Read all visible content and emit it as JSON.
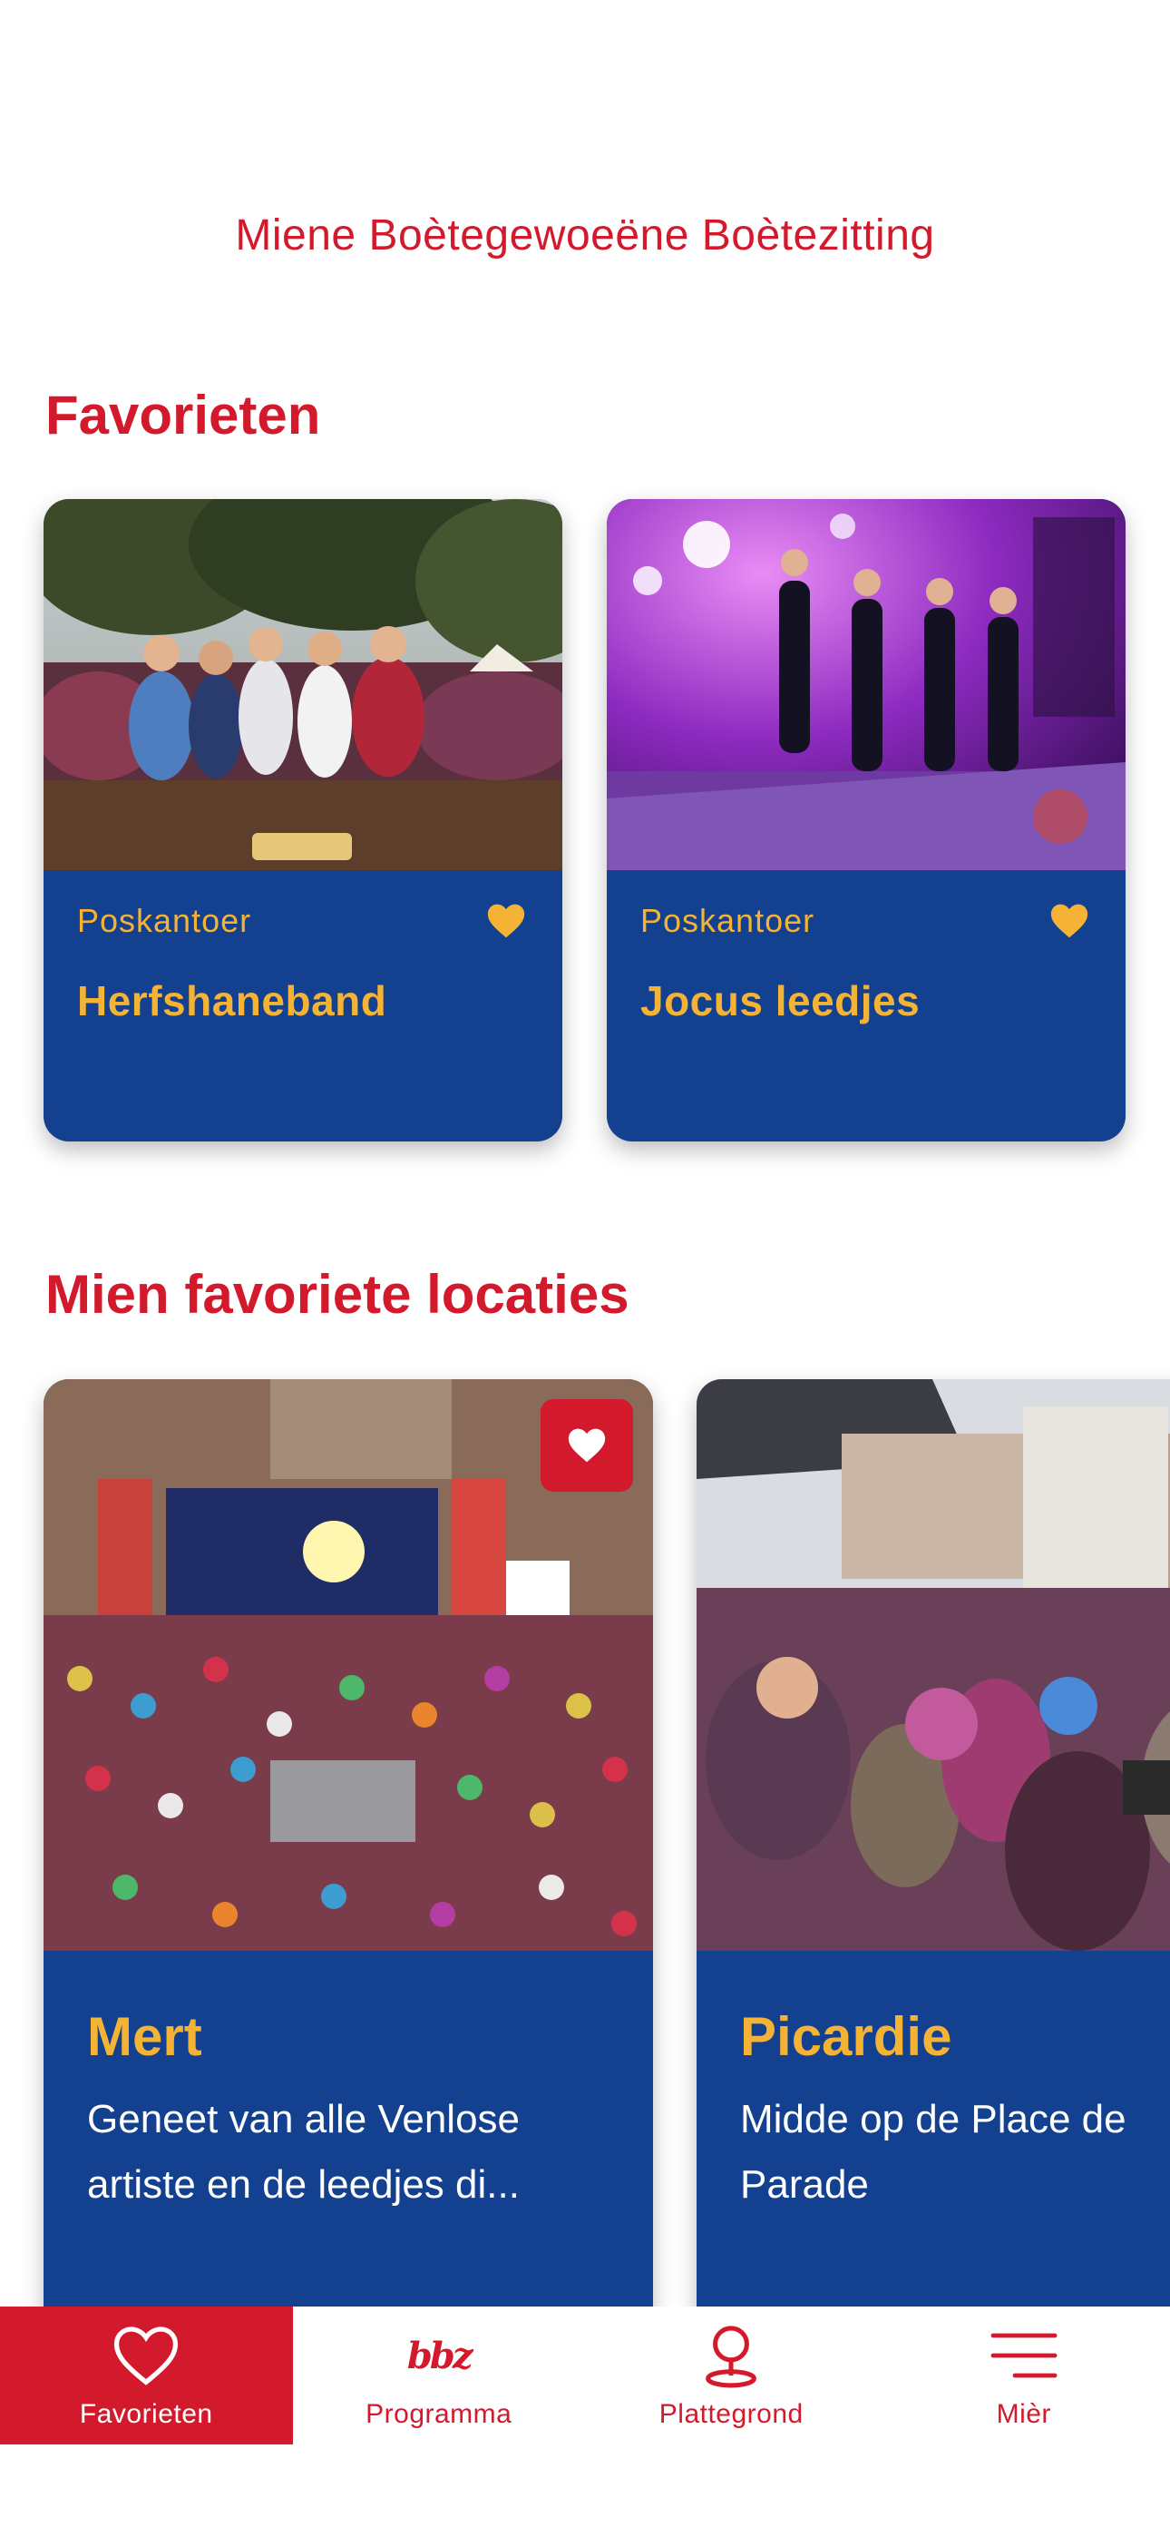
{
  "app": {
    "title": "Miene Boètegewoeëne Boètezitting"
  },
  "favorites": {
    "title": "Favorieten",
    "items": [
      {
        "location": "Poskantoer",
        "name": "Herfshaneband",
        "favorited": true
      },
      {
        "location": "Poskantoer",
        "name": "Jocus leedjes",
        "favorited": true
      }
    ]
  },
  "locations": {
    "title": "Mien favoriete locaties",
    "items": [
      {
        "name": "Mert",
        "description_line1": "Geneet van alle Venlose",
        "description_line2": "artiste en de leedjes di...",
        "favorited": true
      },
      {
        "name": "Picardie",
        "description_line1": "Midde op de Place de",
        "description_line2": "Parade",
        "favorited": false
      }
    ]
  },
  "tabbar": {
    "tabs": [
      {
        "label": "Favorieten",
        "icon": "heart-icon",
        "active": true
      },
      {
        "label": "Programma",
        "icon": "bbz-logo-icon",
        "logo_text": "bbz",
        "active": false
      },
      {
        "label": "Plattegrond",
        "icon": "map-pin-icon",
        "active": false
      },
      {
        "label": "Mièr",
        "icon": "menu-icon",
        "active": false
      }
    ]
  },
  "colors": {
    "brand_red": "#d31a2c",
    "brand_blue": "#13408f",
    "accent_yellow": "#f5b335"
  }
}
